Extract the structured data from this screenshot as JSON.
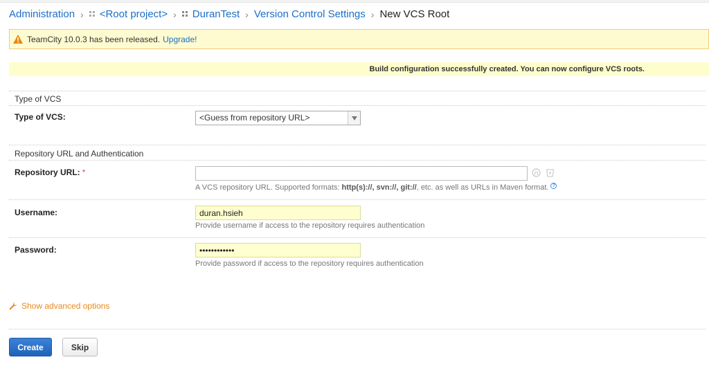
{
  "breadcrumb": {
    "items": [
      {
        "label": "Administration"
      },
      {
        "label": "<Root project>"
      },
      {
        "label": "DuranTest"
      },
      {
        "label": "Version Control Settings"
      }
    ],
    "current": "New VCS Root"
  },
  "release_notice": {
    "text": "TeamCity 10.0.3 has been released.",
    "link": "Upgrade!"
  },
  "success_message": "Build configuration successfully created. You can now configure VCS roots.",
  "sections": {
    "type_of_vcs": {
      "title": "Type of VCS",
      "label": "Type of VCS:",
      "selected": "<Guess from repository URL>"
    },
    "repo_auth": {
      "title": "Repository URL and Authentication",
      "repo_url": {
        "label": "Repository URL:",
        "required_mark": "*",
        "value": "",
        "help_prefix": "A VCS repository URL. Supported formats: ",
        "help_formats": "http(s)://, svn://, git://",
        "help_suffix": ", etc. as well as URLs in Maven format.",
        "help_icon": "?"
      },
      "username": {
        "label": "Username:",
        "value": "duran.hsieh",
        "help": "Provide username if access to the repository requires authentication"
      },
      "password": {
        "label": "Password:",
        "value": "••••••••••••",
        "help": "Provide password if access to the repository requires authentication"
      }
    }
  },
  "advanced_link": "Show advanced options",
  "buttons": {
    "create": "Create",
    "skip": "Skip"
  },
  "colors": {
    "link": "#1a6fc6",
    "accent_orange": "#e9881a",
    "primary_button": "#2a6fc9"
  }
}
